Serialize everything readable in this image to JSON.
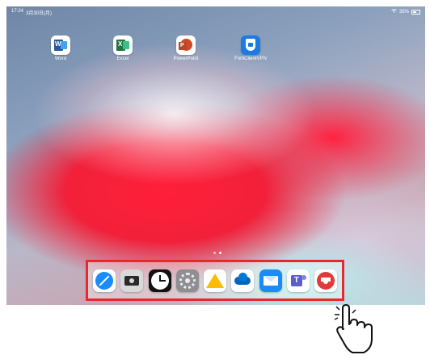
{
  "status_bar": {
    "time": "17:24",
    "date": "3月30日(月)",
    "battery": "35%"
  },
  "home_apps": [
    {
      "name": "Word",
      "icon": "word-icon"
    },
    {
      "name": "Excel",
      "icon": "excel-icon"
    },
    {
      "name": "PowerPoint",
      "icon": "powerpoint-icon"
    },
    {
      "name": "FortiClientVPN",
      "icon": "vpn-icon"
    }
  ],
  "page_dots": {
    "count": 2,
    "active_index": 0
  },
  "dock": {
    "highlight_color": "#e8282d",
    "apps": [
      {
        "name": "Safari",
        "icon": "safari-icon"
      },
      {
        "name": "Camera",
        "icon": "camera-icon"
      },
      {
        "name": "Clock",
        "icon": "clock-icon"
      },
      {
        "name": "Settings",
        "icon": "settings-icon"
      },
      {
        "name": "Google Drive",
        "icon": "google-drive-icon"
      },
      {
        "name": "OneDrive",
        "icon": "onedrive-icon"
      },
      {
        "name": "Mail",
        "icon": "mail-icon"
      },
      {
        "name": "Teams",
        "icon": "teams-icon"
      },
      {
        "name": "Classroom",
        "icon": "graduation-cap-icon"
      }
    ]
  },
  "gesture_icon": "pointing-hand-icon"
}
